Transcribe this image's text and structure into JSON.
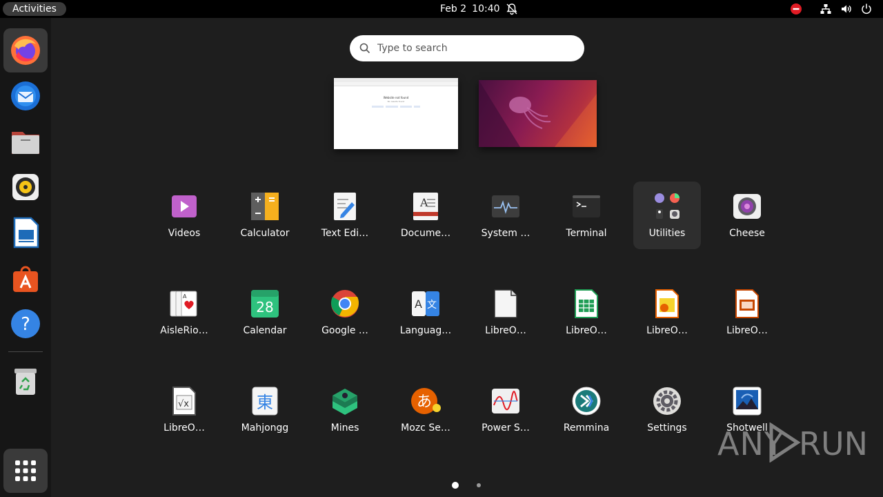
{
  "topbar": {
    "activities_label": "Activities",
    "date": "Feb 2",
    "time": "10:40"
  },
  "dock": {
    "items": [
      {
        "name": "Firefox",
        "icon": "firefox-icon"
      },
      {
        "name": "Thunderbird",
        "icon": "thunderbird-icon"
      },
      {
        "name": "Files",
        "icon": "files-icon"
      },
      {
        "name": "Rhythmbox",
        "icon": "rhythmbox-icon"
      },
      {
        "name": "LibreOffice Writer",
        "icon": "writer-icon"
      },
      {
        "name": "Ubuntu Software",
        "icon": "software-icon"
      },
      {
        "name": "Help",
        "icon": "help-icon"
      },
      {
        "name": "Trash",
        "icon": "trash-icon"
      },
      {
        "name": "Show Applications",
        "icon": "app-grid-icon"
      }
    ]
  },
  "search": {
    "placeholder": "Type to search"
  },
  "workspaces": {
    "ws1_title": "Website not found",
    "ws1_subtitle": "No results found"
  },
  "apps": [
    {
      "label": "Videos",
      "icon": "videos-icon"
    },
    {
      "label": "Calculator",
      "icon": "calculator-icon"
    },
    {
      "label": "Text Edi…",
      "icon": "text-editor-icon"
    },
    {
      "label": "Docume…",
      "icon": "document-viewer-icon"
    },
    {
      "label": "System …",
      "icon": "system-monitor-icon"
    },
    {
      "label": "Terminal",
      "icon": "terminal-icon"
    },
    {
      "label": "Utilities",
      "icon": "utilities-folder-icon"
    },
    {
      "label": "Cheese",
      "icon": "cheese-icon"
    },
    {
      "label": "AisleRio…",
      "icon": "aisleriot-icon"
    },
    {
      "label": "Calendar",
      "icon": "calendar-icon",
      "day": "28"
    },
    {
      "label": "Google …",
      "icon": "chrome-icon"
    },
    {
      "label": "Languag…",
      "icon": "language-icon"
    },
    {
      "label": "LibreO…",
      "icon": "libreoffice-icon"
    },
    {
      "label": "LibreO…",
      "icon": "calc-icon"
    },
    {
      "label": "LibreO…",
      "icon": "draw-icon"
    },
    {
      "label": "LibreO…",
      "icon": "impress-icon"
    },
    {
      "label": "LibreO…",
      "icon": "math-icon"
    },
    {
      "label": "Mahjongg",
      "icon": "mahjongg-icon",
      "glyph": "東"
    },
    {
      "label": "Mines",
      "icon": "mines-icon"
    },
    {
      "label": "Mozc Se…",
      "icon": "mozc-icon",
      "glyph": "あ"
    },
    {
      "label": "Power S…",
      "icon": "power-stats-icon"
    },
    {
      "label": "Remmina",
      "icon": "remmina-icon"
    },
    {
      "label": "Settings",
      "icon": "settings-icon"
    },
    {
      "label": "Shotwell",
      "icon": "shotwell-icon"
    }
  ],
  "pager": {
    "pages": 2,
    "current": 1
  },
  "watermark": {
    "left": "ANY",
    "right": "RUN"
  },
  "colors": {
    "accent": "#e95420",
    "dock": "#161616",
    "overview": "#1e1e1e"
  }
}
